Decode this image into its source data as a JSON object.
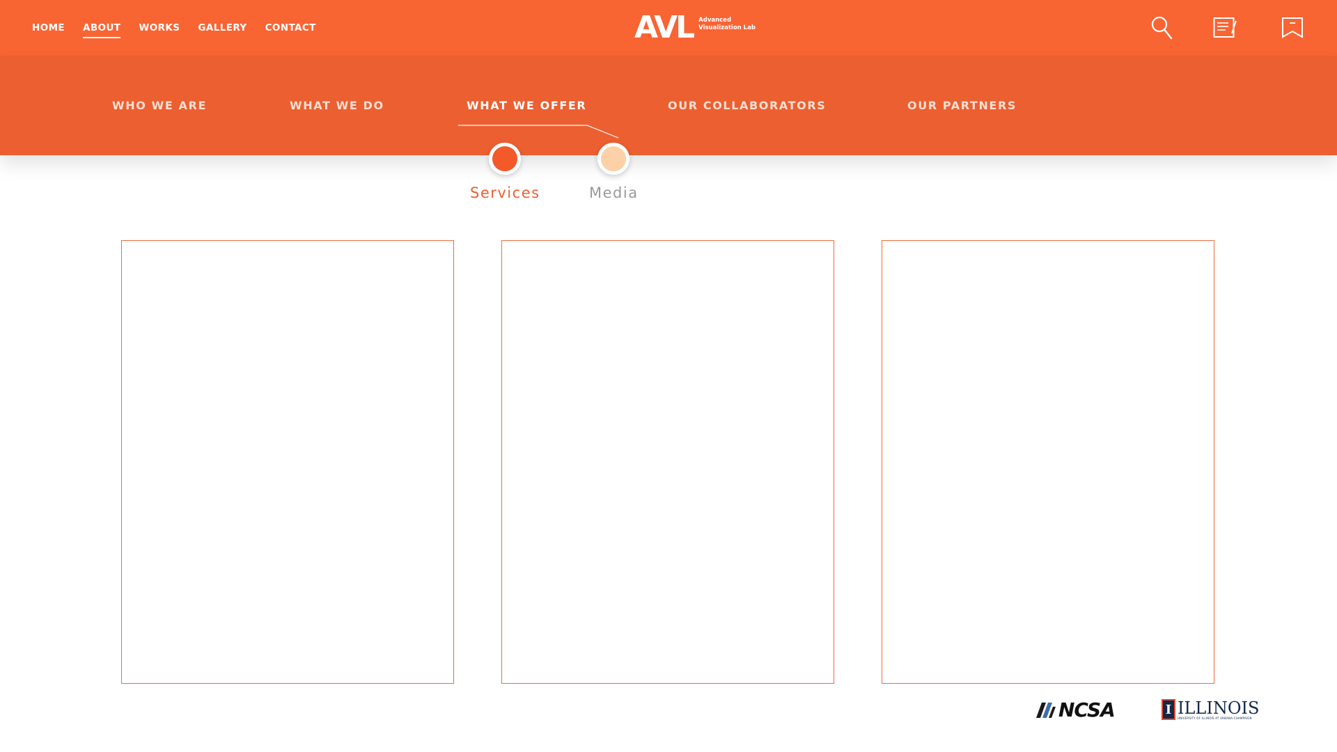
{
  "colors": {
    "topbar": "#f96433",
    "subnav": "#ec5f31",
    "accent": "#ef6a3c",
    "tab_active_dot": "#f4592a",
    "tab_inactive_dot": "#fdd0a8",
    "tab_active_text": "#ec5f31",
    "tab_inactive_text": "#9a9a9a"
  },
  "main_nav": {
    "items": [
      {
        "label": "HOME",
        "active": false
      },
      {
        "label": "ABOUT",
        "active": true
      },
      {
        "label": "WORKS",
        "active": false
      },
      {
        "label": "GALLERY",
        "active": false
      },
      {
        "label": "CONTACT",
        "active": false
      }
    ]
  },
  "logo": {
    "mark": "AVL",
    "line1": "Advanced",
    "line2": "Visualization Lab"
  },
  "top_icons": [
    "search-icon",
    "notepad-icon",
    "bookmark-icon"
  ],
  "sub_nav": {
    "items": [
      {
        "label": "WHO WE ARE",
        "active": false
      },
      {
        "label": "WHAT WE DO",
        "active": false
      },
      {
        "label": "WHAT WE OFFER",
        "active": true
      },
      {
        "label": "OUR COLLABORATORS",
        "active": false
      },
      {
        "label": "OUR PARTNERS",
        "active": false
      }
    ]
  },
  "sub_tabs": [
    {
      "label": "Services",
      "active": true
    },
    {
      "label": "Media",
      "active": false
    }
  ],
  "cards_count_label": "",
  "footer": {
    "ncsa": "NCSA",
    "illinois_letter": "I",
    "illinois": "ILLINOIS",
    "illinois_small": "UNIVERSITY OF ILLINOIS AT URBANA-CHAMPAIGN"
  }
}
